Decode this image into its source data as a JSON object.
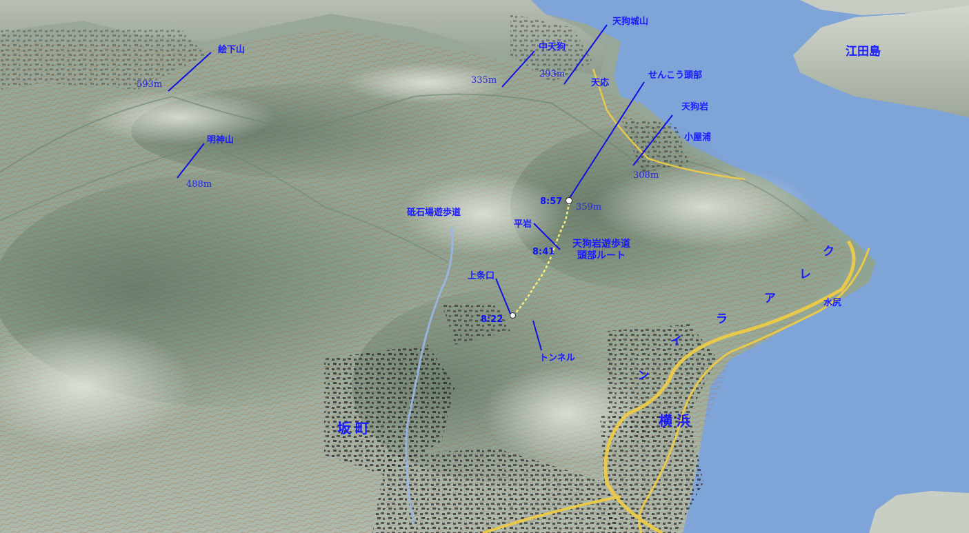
{
  "colors": {
    "sea": "#7fa4d8",
    "label": "#1a1aff",
    "terrain_ridge": "#c6cec0",
    "terrain_valley": "#5b7a5e",
    "contour": "#b36a3a",
    "road": "#e8c94a",
    "route": "#f4f07a"
  },
  "icons": {
    "summit_marker": "circle-marker-icon",
    "trailhead_marker": "circle-marker-icon"
  },
  "labels": {
    "ekashitayama": "絵下山",
    "ekashitayama_elev": "593m",
    "myojinsan": "明神山",
    "myojinsan_elev": "488m",
    "nakatengu": "中天狗",
    "nakatengu_elev": "335m",
    "tengujoyama": "天狗城山",
    "tengujoyama_elev": "293m",
    "tenno": "天応",
    "senko_head": "せんこう頭部",
    "summit_elev": "359m",
    "tenguiwa": "天狗岩",
    "koyaura": "小屋浦",
    "tenguiwa_elev": "308m",
    "etajima": "江田島",
    "toishiba_trail": "砥石場遊歩道",
    "hiraiwa": "平岩",
    "route_name_line1": "天狗岩遊歩道",
    "route_name_line2": "頭部ルート",
    "kamijoguchi": "上条口",
    "tunnel": "トンネル",
    "mizushiri": "水尻",
    "sakamachi": "坂町",
    "yokohama": "横浜"
  },
  "times": {
    "summit": "8:57",
    "hiraiwa": "8:41",
    "start": "8:22"
  },
  "kure_line": [
    "ク",
    "レ",
    "ア",
    "ラ",
    "イ",
    "ン"
  ]
}
